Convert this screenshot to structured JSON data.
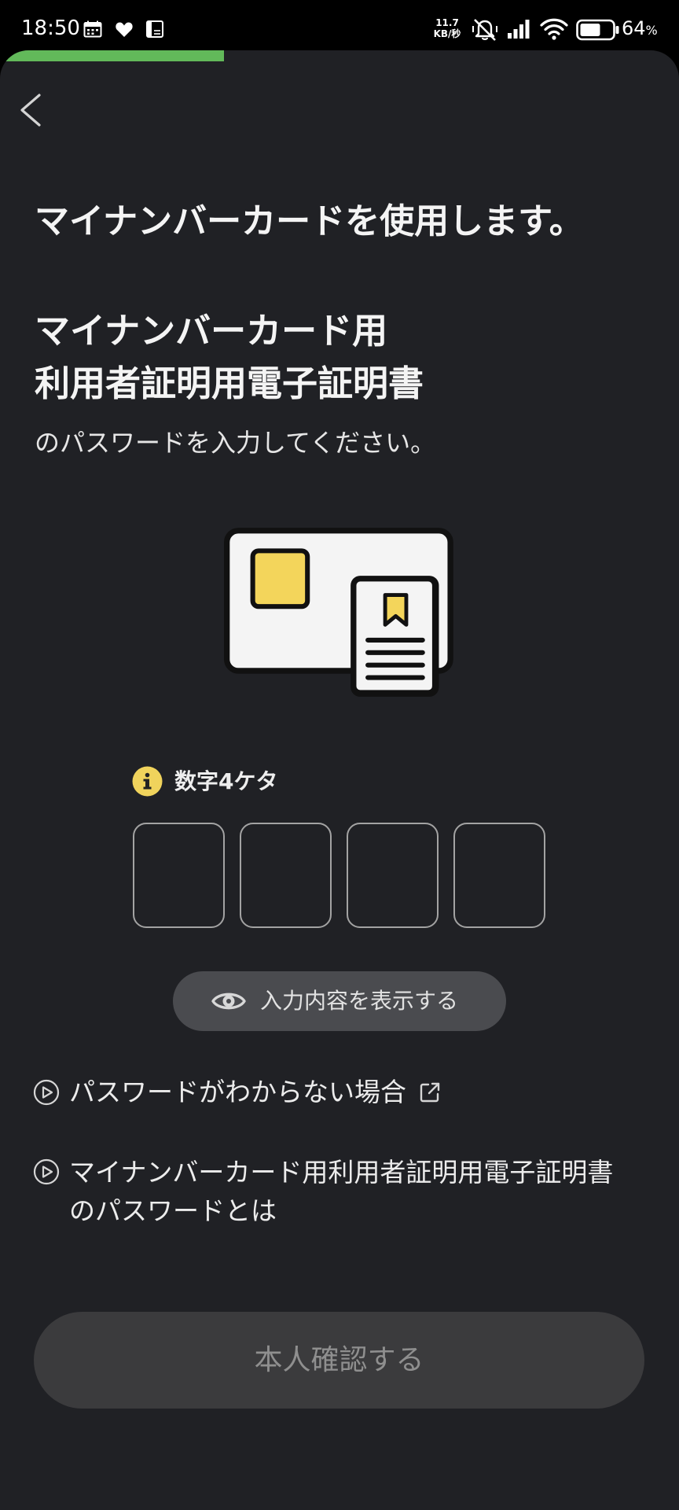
{
  "status_bar": {
    "time": "18:50",
    "net_speed_value": "11.7",
    "net_speed_unit": "KB/秒",
    "battery_percent": "64",
    "battery_symbol": "%",
    "icons": [
      "calendar-icon",
      "heart-icon",
      "app-notification-icon",
      "mute-icon",
      "signal-icon",
      "wifi-icon",
      "battery-icon"
    ]
  },
  "progress": {
    "fraction": 0.33
  },
  "header": {
    "back_icon": "chevron-left-icon"
  },
  "intro": {
    "title": "マイナンバーカードを使用します。"
  },
  "certificate": {
    "line1": "マイナンバーカード用",
    "line2": "利用者証明用電子証明書",
    "instruction": "のパスワードを入力してください。"
  },
  "illustration": {
    "icon": "my-number-card-illustration"
  },
  "pin": {
    "hint_icon": "info-icon",
    "hint": "数字4ケタ",
    "digits": [
      "",
      "",
      "",
      ""
    ]
  },
  "toggle": {
    "icon": "eye-icon",
    "label": "入力内容を表示する"
  },
  "links": [
    {
      "icon": "play-circle-icon",
      "label": "パスワードがわからない場合",
      "trailing_icon": "external-link-icon"
    },
    {
      "icon": "play-circle-icon",
      "label_line1": "マイナンバーカード用利用者証明用電子証明書",
      "label_line2": "のパスワードとは"
    }
  ],
  "submit": {
    "label": "本人確認する",
    "enabled": false
  },
  "colors": {
    "background": "#202125",
    "status_bar": "#000000",
    "progress": "#62b95a",
    "chip_yellow": "#f3d55b",
    "info_yellow": "#f0d35c",
    "toggle_bg": "#4a4b4f",
    "submit_bg": "#3b3b3d",
    "submit_text": "#8f8f8f"
  }
}
